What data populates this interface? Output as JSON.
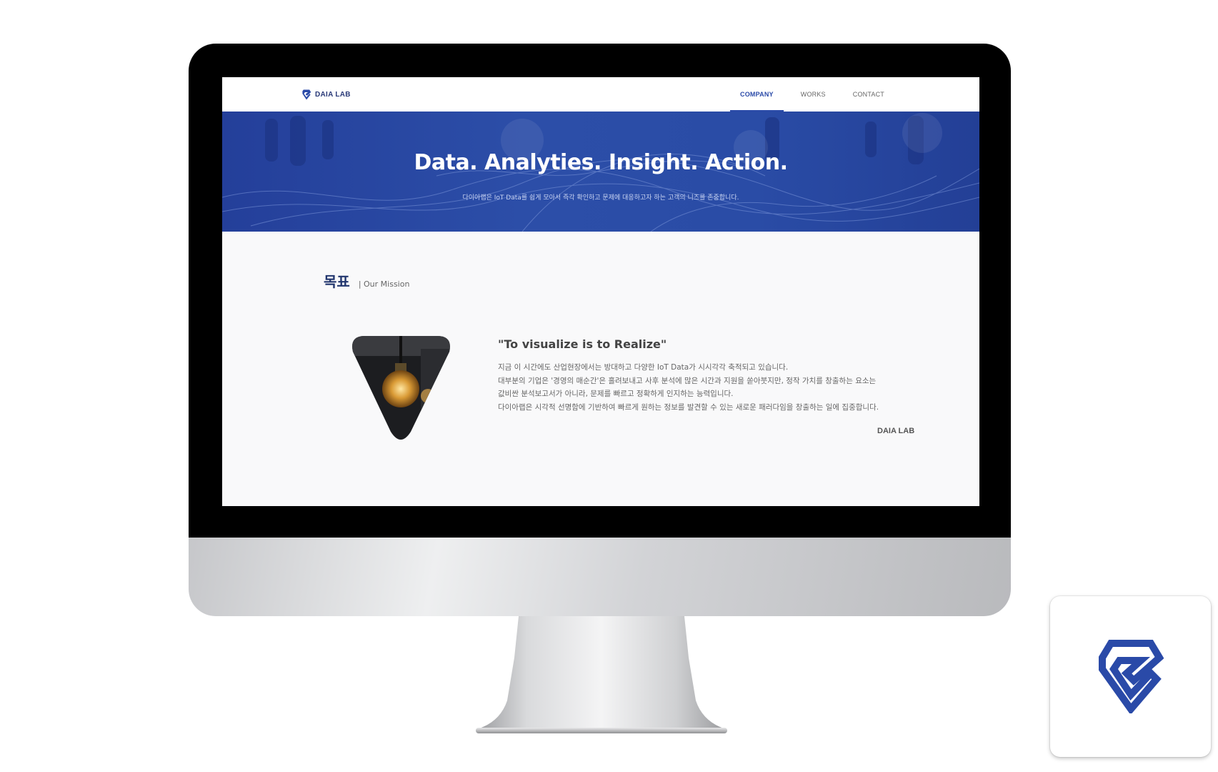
{
  "header": {
    "logo_text": "DAIA LAB",
    "nav": [
      {
        "label": "COMPANY",
        "active": true
      },
      {
        "label": "WORKS",
        "active": false
      },
      {
        "label": "CONTACT",
        "active": false
      }
    ]
  },
  "hero": {
    "title": "Data. Analyties. Insight. Action.",
    "subtitle": "다이아랩은 IoT Data를 쉽게 모아서 즉각 확인하고 문제에 대응하고자 하는 고객의 니즈를 존중합니다."
  },
  "mission": {
    "heading_ko": "목표",
    "heading_en": "| Our Mission",
    "quote": "\"To visualize is to Realize\"",
    "lines": [
      "지금 이 시간에도 산업현장에서는 방대하고 다양한 IoT Data가 시시각각 축적되고 있습니다.",
      "대부분의 기업은 '경영의 매순간'은 흘려보내고 사후 분석에 많은 시간과 지원을 쏟아붓지만, 정작 가치를 창출하는 요소는",
      "값비싼 분석보고서가 아니라, 문제를 빠르고 정확하게 인지하는 능력입니다.",
      "다이아랩은 시각적 선명함에 기반하여 빠르게 원하는 정보를 발견할 수 있는 새로운 패러다임을 창출하는 일에 집중합니다."
    ],
    "signature": "DAIA LAB"
  },
  "colors": {
    "brand_blue": "#2a4aa8",
    "hero_blue": "#2c4ea8",
    "heading_navy": "#22366e"
  },
  "icons": [
    "daia-logo-icon",
    "lightbulb-image",
    "app-icon-logo"
  ]
}
